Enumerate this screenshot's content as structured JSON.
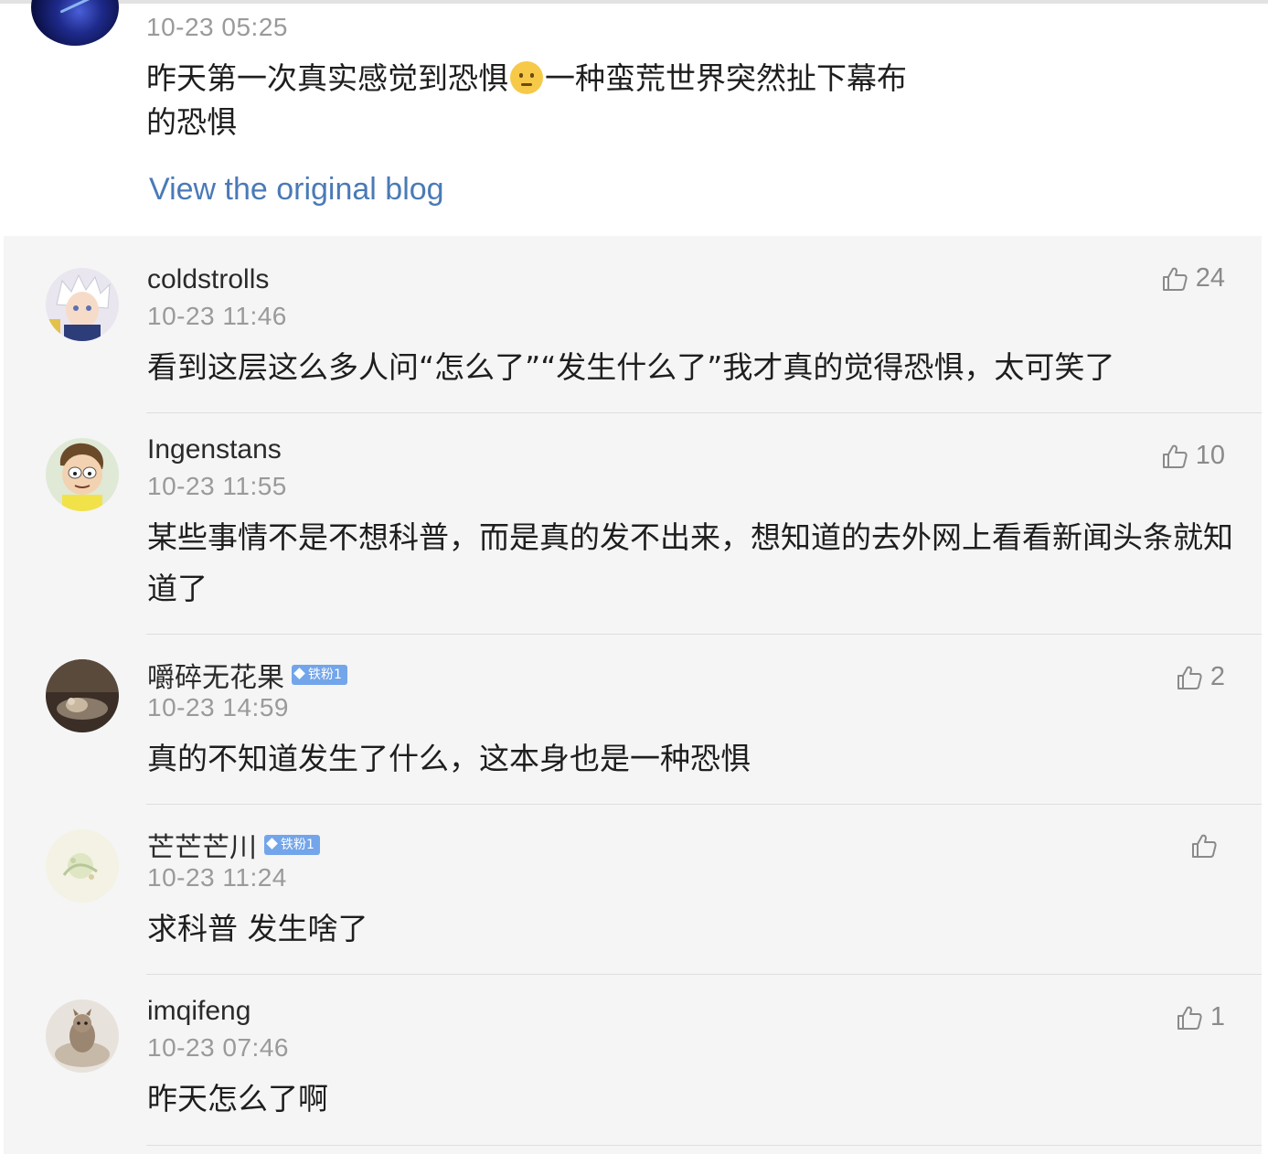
{
  "post": {
    "time": "10-23 05:25",
    "text_before_emoji": "昨天第一次真实感觉到恐惧",
    "emoji": "pleading-face-emoji",
    "text_after_emoji": "一种蛮荒世界突然扯下幕布的恐惧",
    "view_original_label": "View the original blog"
  },
  "comments": [
    {
      "username": "coldstrolls",
      "badge": "",
      "time": "10-23 11:46",
      "text": "看到这层这么多人问“怎么了”“发生什么了”我才真的觉得恐惧，太可笑了",
      "likes": "24"
    },
    {
      "username": "Ingenstans",
      "badge": "",
      "time": "10-23 11:55",
      "text": "某些事情不是不想科普，而是真的发不出来，想知道的去外网上看看新闻头条就知道了",
      "likes": "10"
    },
    {
      "username": "嚼碎无花果",
      "badge": "铁粉1",
      "time": "10-23 14:59",
      "text": "真的不知道发生了什么，这本身也是一种恐惧",
      "likes": "2"
    },
    {
      "username": "芒芒芒川",
      "badge": "铁粉1",
      "time": "10-23 11:24",
      "text": "求科普 发生啥了",
      "likes": ""
    },
    {
      "username": "imqifeng",
      "badge": "",
      "time": "10-23 07:46",
      "text": "昨天怎么了啊",
      "likes": "1"
    }
  ],
  "icons": {
    "like": "thumbs-up-icon"
  },
  "colors": {
    "link": "#4a7ab6",
    "timestamp": "#9a9a9a",
    "badge": "#73a5ea",
    "comment_bg": "#f5f5f5"
  }
}
